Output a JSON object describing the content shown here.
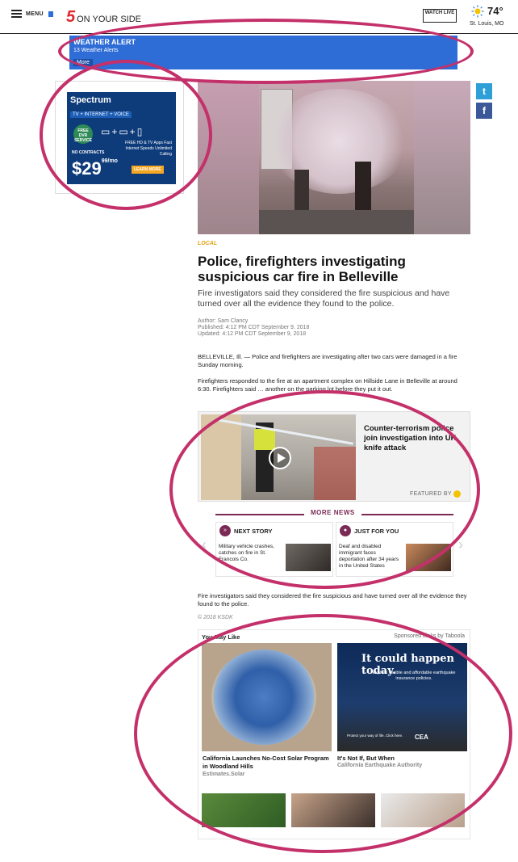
{
  "header": {
    "menu_label": "MENU",
    "logo_number": "5",
    "logo_text": "ON YOUR SIDE",
    "watch_live": "WATCH LIVE",
    "temperature": "74°",
    "city": "St. Louis, MO"
  },
  "alert": {
    "title": "WEATHER ALERT",
    "subtitle": "13 Weather Alerts",
    "more": "More"
  },
  "ad": {
    "brand": "Spectrum",
    "tagline": "TV + INTERNET + VOICE",
    "dvr": "FREE DVR SERVICE",
    "no_contracts": "NO CONTRACTS",
    "price": "$29",
    "cents": "99/mo",
    "apps": "FREE HD & TV Apps Fast Internet Speeds Unlimited Calling",
    "learn_more": "LEARN MORE"
  },
  "article": {
    "tag": "LOCAL",
    "headline": "Police, firefighters investigating suspicious car fire in Belleville",
    "dek": "Fire investigators said they considered the fire suspicious and have turned over all the evidence they found to the police.",
    "author": "Author: Sam Clancy",
    "published": "Published: 4:12 PM CDT September 9, 2018",
    "updated": "Updated: 4:12 PM CDT September 9, 2018",
    "p1": "BELLEVILLE, Ill. — Police and firefighters are investigating after two cars were damaged in a fire Sunday morning.",
    "p2": "Firefighters responded to the fire at an apartment complex on Hillside Lane in Belleville at around 6:30. Firefighters said … another on the parking lot before they put it out.",
    "p3": "Fire investigators said they considered the fire suspicious and have turned over all the evidence they found to the police.",
    "copyright": "© 2018 KSDK"
  },
  "featured": {
    "title": "Counter-terrorism police join investigation into UK knife attack",
    "featured_by": "FEATURED BY"
  },
  "more_news": {
    "title": "MORE NEWS",
    "next_label": "NEXT STORY",
    "next_text": "Military vehicle crashes, catches on fire in St. Francois Co.",
    "jfy_label": "JUST FOR YOU",
    "jfy_text": "Deaf and disabled immigrant faces deportation after 34 years in the United States"
  },
  "taboola": {
    "you_may_like": "You May Like",
    "sponsored": "Sponsored Links by Taboola",
    "tile1_title": "California Launches No-Cost Solar Program in Woodland Hills",
    "tile1_source": "Estimates.Solar",
    "tile2_big": "It could happen today.",
    "tile2_small": "Explore flexible and affordable earthquake insurance policies.",
    "tile2_protect": "Protect your way of life. Click here.",
    "tile2_logo": "CEA",
    "tile2_title": "It's Not If, But When",
    "tile2_source": "California Earthquake Authority"
  },
  "social": {
    "twitter": "t",
    "facebook": "f"
  }
}
